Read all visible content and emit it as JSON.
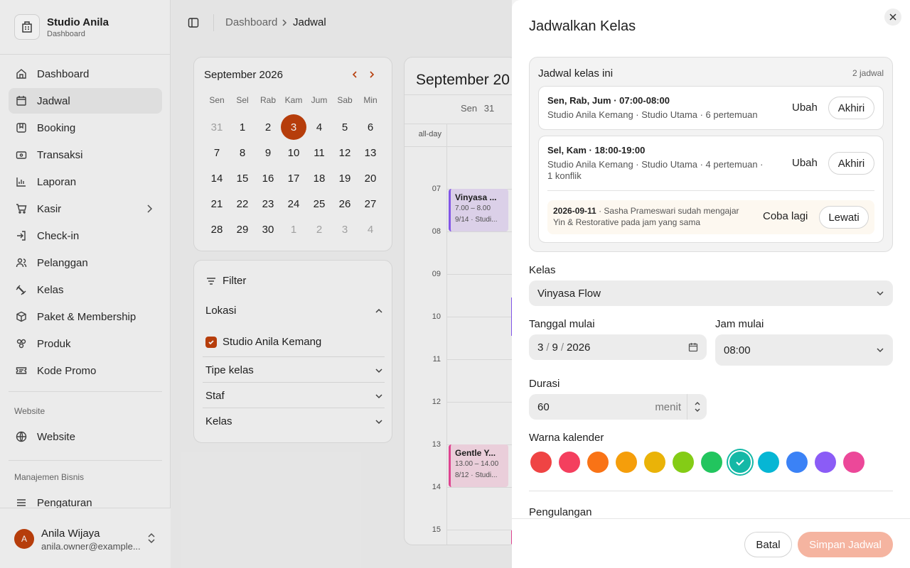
{
  "brand": {
    "name": "Studio Anila",
    "sub": "Dashboard"
  },
  "sidebar": {
    "items": [
      {
        "label": "Dashboard",
        "icon": "home-icon"
      },
      {
        "label": "Jadwal",
        "icon": "calendar-icon",
        "active": true
      },
      {
        "label": "Booking",
        "icon": "bookmark-icon"
      },
      {
        "label": "Transaksi",
        "icon": "wallet-icon"
      },
      {
        "label": "Laporan",
        "icon": "bar-chart-icon"
      },
      {
        "label": "Kasir",
        "icon": "cart-icon",
        "has_submenu": true
      },
      {
        "label": "Check-in",
        "icon": "check-in-icon"
      },
      {
        "label": "Pelanggan",
        "icon": "users-icon"
      },
      {
        "label": "Kelas",
        "icon": "dumbbell-icon"
      },
      {
        "label": "Paket & Membership",
        "icon": "package-icon"
      },
      {
        "label": "Produk",
        "icon": "product-icon"
      },
      {
        "label": "Kode Promo",
        "icon": "ticket-icon"
      }
    ],
    "website_section": "Website",
    "website_item": "Website",
    "business_section": "Manajemen Bisnis",
    "business_item": "Pengaturan"
  },
  "user": {
    "initial": "A",
    "name": "Anila Wijaya",
    "email": "anila.owner@example..."
  },
  "breadcrumb": {
    "parent": "Dashboard",
    "current": "Jadwal"
  },
  "mini_calendar": {
    "title": "September 2026",
    "weekdays": [
      "Sen",
      "Sel",
      "Rab",
      "Kam",
      "Jum",
      "Sab",
      "Min"
    ],
    "weeks": [
      [
        "31",
        "1",
        "2",
        "3",
        "4",
        "5",
        "6"
      ],
      [
        "7",
        "8",
        "9",
        "10",
        "11",
        "12",
        "13"
      ],
      [
        "14",
        "15",
        "16",
        "17",
        "18",
        "19",
        "20"
      ],
      [
        "21",
        "22",
        "23",
        "24",
        "25",
        "26",
        "27"
      ],
      [
        "28",
        "29",
        "30",
        "1",
        "2",
        "3",
        "4"
      ]
    ],
    "today": "3"
  },
  "filter": {
    "title": "Filter",
    "location_label": "Lokasi",
    "location_option": "Studio Anila Kemang",
    "class_type": "Tipe kelas",
    "staff": "Staf",
    "classes": "Kelas"
  },
  "week_view": {
    "title": "September 20",
    "day_label": "Sen",
    "day_number": "31",
    "all_day": "all-day",
    "hours": [
      "07",
      "08",
      "09",
      "10",
      "11",
      "12",
      "13",
      "14",
      "15"
    ],
    "events": [
      {
        "title": "Vinyasa ...",
        "time": "7.00 – 8.00",
        "meta": "9/14 · Studi..."
      },
      {
        "title": "Gentle Y...",
        "time": "13.00 – 14.00",
        "meta": "8/12 · Studi..."
      }
    ]
  },
  "modal": {
    "title": "Jadwalkan Kelas",
    "schedule_box": {
      "title": "Jadwal kelas ini",
      "count": "2 jadwal",
      "items": [
        {
          "title": "Sen, Rab, Jum · 07:00-08:00",
          "sub": "Studio Anila Kemang · Studio Utama · 6 pertemuan",
          "edit": "Ubah",
          "end": "Akhiri"
        },
        {
          "title": "Sel, Kam · 18:00-19:00",
          "sub": "Studio Anila Kemang · Studio Utama · 4 pertemuan · 1 konflik",
          "edit": "Ubah",
          "end": "Akhiri"
        }
      ],
      "conflict": {
        "date": "2026-09-11",
        "text": "Sasha Prameswari sudah mengajar Yin & Restorative pada jam yang sama",
        "retry": "Coba lagi",
        "skip": "Lewati"
      }
    },
    "class_label": "Kelas",
    "class_value": "Vinyasa Flow",
    "start_date_label": "Tanggal mulai",
    "start_date": {
      "day": "3",
      "month": "9",
      "year": "2026"
    },
    "start_time_label": "Jam mulai",
    "start_time": "08:00",
    "duration_label": "Durasi",
    "duration_value": "60",
    "duration_unit": "menit",
    "color_label": "Warna kalender",
    "colors": [
      "#ef4444",
      "#f43f5e",
      "#f97316",
      "#f59e0b",
      "#eab308",
      "#84cc16",
      "#22c55e",
      "#14b8a6",
      "#06b6d4",
      "#3b82f6",
      "#8b5cf6",
      "#ec4899"
    ],
    "selected_color": "#14b8a6",
    "repeat_label": "Pengulangan",
    "cancel": "Batal",
    "save": "Simpan Jadwal"
  }
}
